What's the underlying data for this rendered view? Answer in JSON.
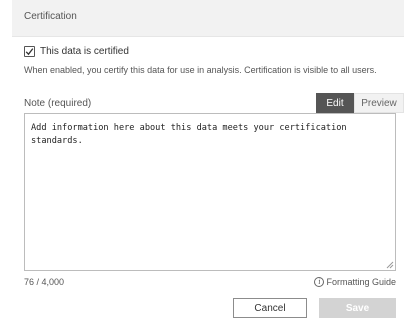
{
  "dialog": {
    "title": "Certification",
    "certified": {
      "checked": true,
      "label": "This data is certified"
    },
    "description": "When enabled, you certify this data for use in analysis. Certification is visible to all users.",
    "note": {
      "label": "Note (required)",
      "tabs": [
        {
          "label": "Edit",
          "active": true
        },
        {
          "label": "Preview",
          "active": false
        }
      ],
      "value": "Add information here about this data meets your certification\nstandards.",
      "char_count": "76 / 4,000"
    },
    "formatting_guide": "Formatting Guide",
    "buttons": {
      "cancel": "Cancel",
      "save": "Save"
    }
  },
  "colors": {
    "active_tab": "#555555",
    "save_disabled": "#d3d3d3",
    "header_bg": "#f2f2f2"
  },
  "icons": {
    "checkbox": "checkmark-icon",
    "info": "info-icon",
    "resize": "resize-grip-icon"
  }
}
